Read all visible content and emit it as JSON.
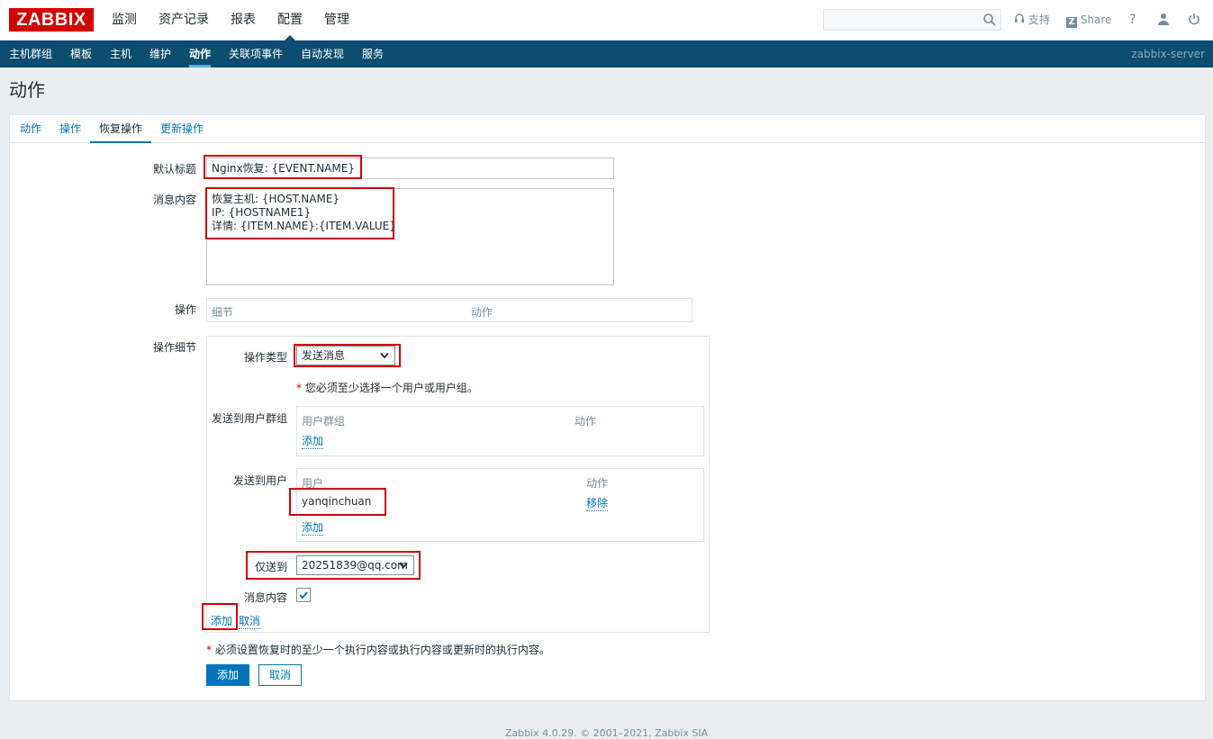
{
  "header": {
    "logo": "ZABBIX",
    "menu": [
      "监测",
      "资产记录",
      "报表",
      "配置",
      "管理"
    ],
    "active_menu": "配置",
    "search_placeholder": "",
    "support_label": "支持",
    "share_label": "Share",
    "help_label": "?"
  },
  "submenu": {
    "items": [
      "主机群组",
      "模板",
      "主机",
      "维护",
      "动作",
      "关联项事件",
      "自动发现",
      "服务"
    ],
    "active": "动作",
    "server": "zabbix-server"
  },
  "page": {
    "title": "动作"
  },
  "tabs": [
    "动作",
    "操作",
    "恢复操作",
    "更新操作"
  ],
  "active_tab": "恢复操作",
  "form": {
    "default_subject_label": "默认标题",
    "default_subject_value": "Nginx恢复: {EVENT.NAME}",
    "message_label": "消息内容",
    "message_value": "恢复主机: {HOST.NAME}\nIP: {HOSTNAME1}\n详情: {ITEM.NAME}:{ITEM.VALUE}",
    "operations_label": "操作",
    "operations_cols": [
      "细节",
      "动作"
    ],
    "op_details_label": "操作细节",
    "op_type_label": "操作类型",
    "op_type_value": "发送消息",
    "must_select_note": "您必须至少选择一个用户或用户组。",
    "send_groups_label": "发送到用户群组",
    "groups_cols": [
      "用户群组",
      "动作"
    ],
    "groups_add": "添加",
    "send_users_label": "发送到用户",
    "users_cols": [
      "用户",
      "动作"
    ],
    "users": [
      {
        "name": "yanqinchuan",
        "action": "移除"
      }
    ],
    "users_add": "添加",
    "send_only_label": "仅送到",
    "send_only_value": "20251839@qq.com",
    "message_content_label": "消息内容",
    "message_content_checked": true,
    "details_add": "添加",
    "details_cancel": "取消",
    "bottom_note": "必须设置恢复时的至少一个执行内容或执行内容或更新时的执行内容。",
    "submit": "添加",
    "cancel": "取消"
  },
  "footer": "Zabbix 4.0.29. © 2001–2021, Zabbix SIA",
  "colors": {
    "accent": "#0275b8",
    "nav": "#0c4d70",
    "logo": "#d40000",
    "highlight": "#d20000"
  }
}
